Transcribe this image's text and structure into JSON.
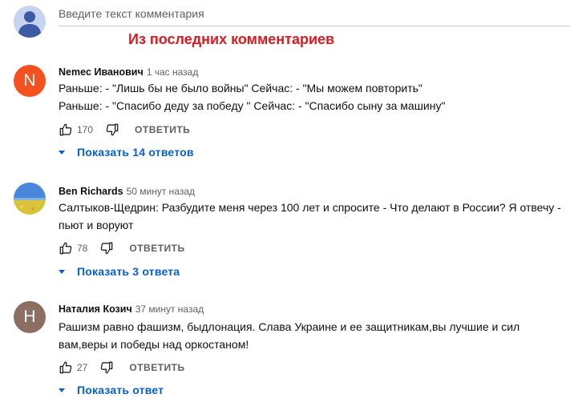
{
  "comment_box": {
    "placeholder": "Введите текст комментария"
  },
  "headline": "Из последних комментариев",
  "comments": [
    {
      "author": "Nemec Иванович",
      "time": "1 час назад",
      "avatar_letter": "N",
      "avatar_color": "#f4511e",
      "lines": [
        "Раньше: - \"Лишь бы не было войны\" Сейчас: - \"Мы можем повторить\"",
        "Раньше: - \"Спасибо деду за победу \" Сейчас: - \"Спасибо сыну за машину\""
      ],
      "likes": "170",
      "reply_label": "ОТВЕТИТЬ",
      "replies_label": "Показать 14 ответов"
    },
    {
      "author": "Ben Richards",
      "time": "50 минут назад",
      "avatar_letter": "",
      "avatar_color": "#3a7bd5",
      "lines": [
        "Салтыков-Щедрин: Разбудите меня через 100 лет и спросите - Что делают в России? Я отвечу -",
        "пьют и воруют"
      ],
      "likes": "78",
      "reply_label": "ОТВЕТИТЬ",
      "replies_label": "Показать 3 ответа"
    },
    {
      "author": "Наталия Козич",
      "time": "37 минут назад",
      "avatar_letter": "Н",
      "avatar_color": "#8d6e63",
      "lines": [
        "Рашизм равно фашизм, быдлонация. Слава Украине и ее защитникам,вы лучшие и сил",
        "вам,веры и победы над оркостаном!"
      ],
      "likes": "27",
      "reply_label": "ОТВЕТИТЬ",
      "replies_label": "Показать ответ"
    }
  ]
}
